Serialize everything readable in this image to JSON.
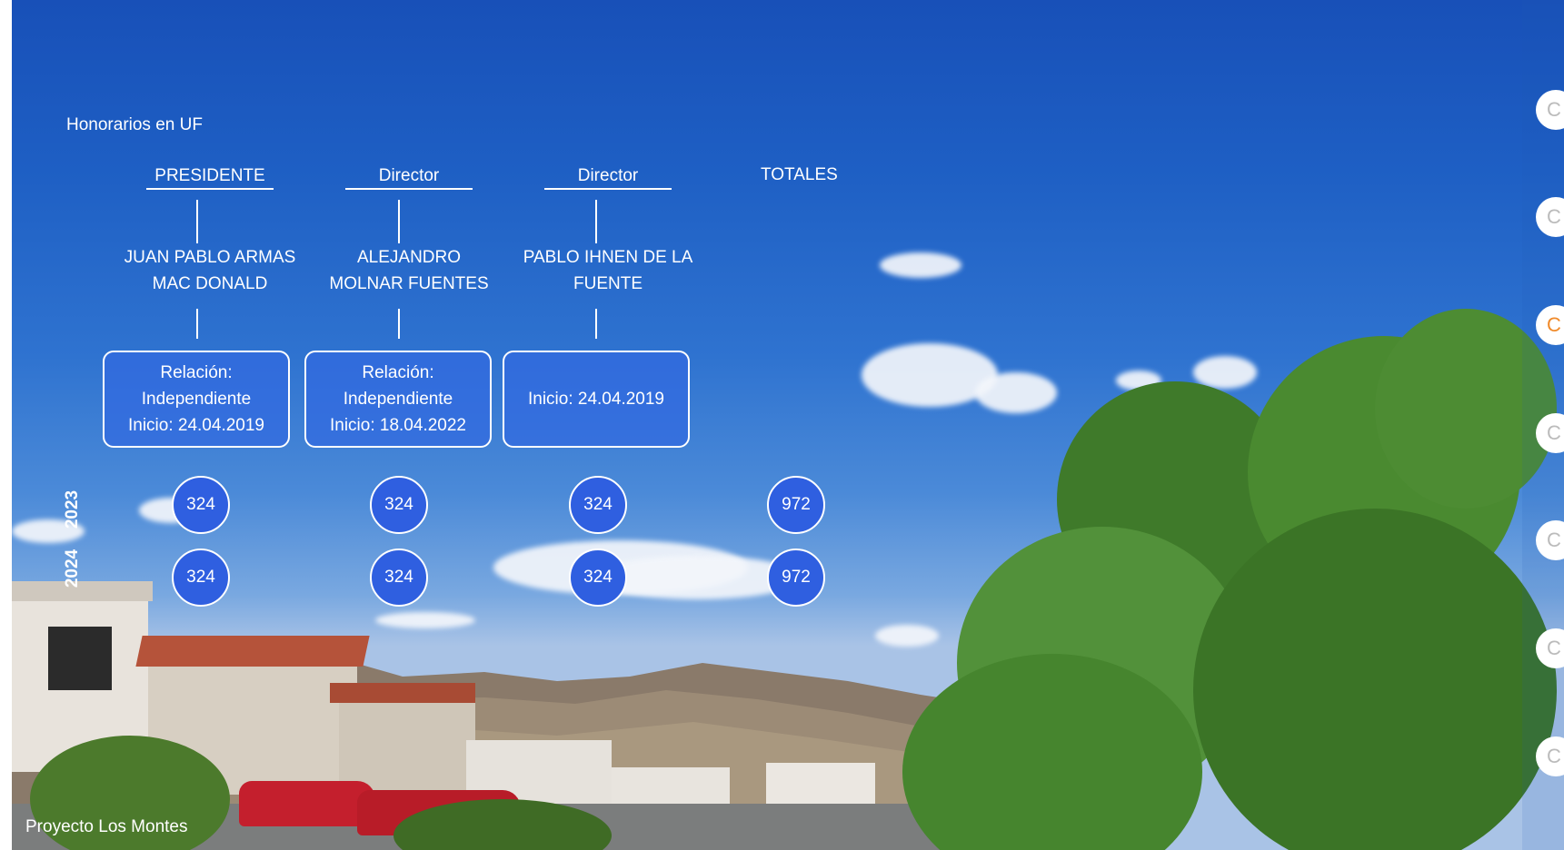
{
  "section_title": "Honorarios en UF",
  "columns": [
    {
      "role": "PRESIDENTE",
      "name_line1": "JUAN PABLO ARMAS",
      "name_line2": "MAC DONALD",
      "rel_line1": "Relación:",
      "rel_line2": "Independiente",
      "rel_line3": "Inicio: 24.04.2019",
      "fee_2023": "324",
      "fee_2024": "324"
    },
    {
      "role": "Director",
      "name_line1": "ALEJANDRO",
      "name_line2": "MOLNAR FUENTES",
      "rel_line1": "Relación:",
      "rel_line2": "Independiente",
      "rel_line3": "Inicio: 18.04.2022",
      "fee_2023": "324",
      "fee_2024": "324"
    },
    {
      "role": "Director",
      "name_line1": "PABLO IHNEN DE LA",
      "name_line2": "FUENTE",
      "rel_line1": "Inicio: 24.04.2019",
      "fee_2023": "324",
      "fee_2024": "324"
    }
  ],
  "totals": {
    "label": "TOTALES",
    "value_2023": "972",
    "value_2024": "972"
  },
  "years": [
    "2023",
    "2024"
  ],
  "caption": "Proyecto Los Montes",
  "nav_dots": {
    "glyph": "C",
    "active_color": "#f08a2a"
  }
}
